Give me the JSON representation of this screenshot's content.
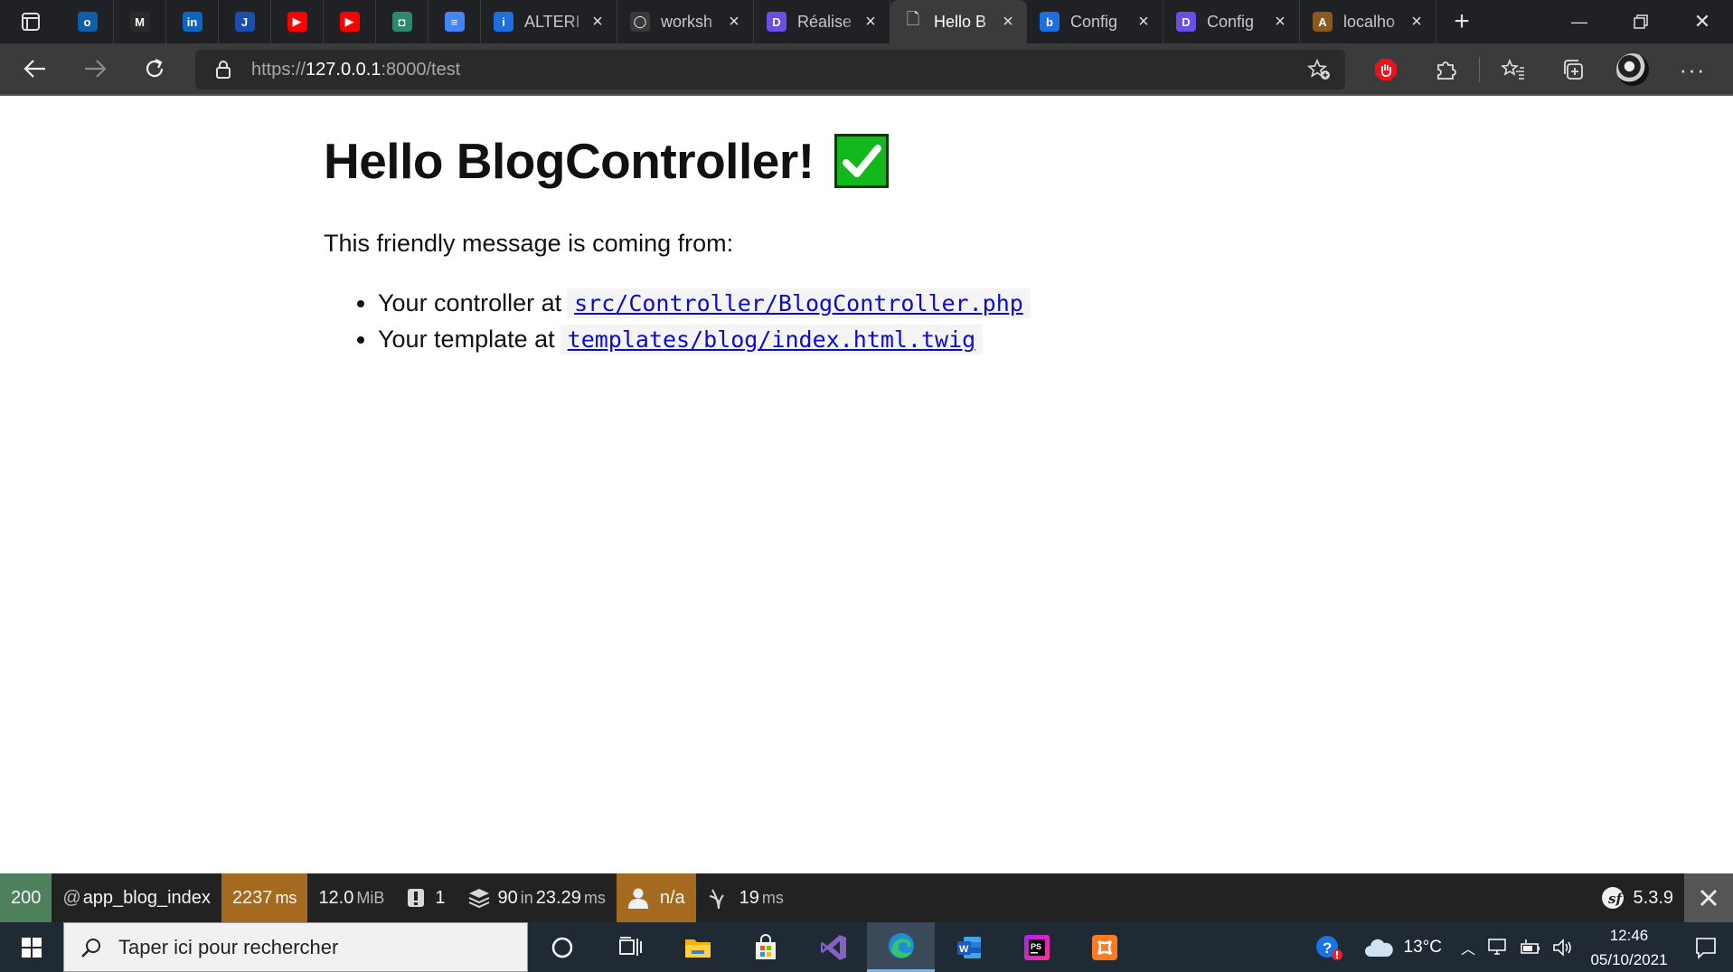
{
  "browser": {
    "pinned_tabs": [
      {
        "name": "outlook",
        "glyph": "o",
        "color": "#0f5ea8"
      },
      {
        "name": "gmail",
        "glyph": "M",
        "color": "#2a2a2a"
      },
      {
        "name": "linkedin",
        "glyph": "in",
        "color": "#0a66c2"
      },
      {
        "name": "jira",
        "glyph": "J",
        "color": "#1a4fb0"
      },
      {
        "name": "youtube",
        "glyph": "▶",
        "color": "#ff0000"
      },
      {
        "name": "youtube",
        "glyph": "▶",
        "color": "#ff0000"
      },
      {
        "name": "app",
        "glyph": "◘",
        "color": "#2d8a6e"
      },
      {
        "name": "docs",
        "glyph": "≡",
        "color": "#4285f4"
      }
    ],
    "tabs": [
      {
        "title": "ALTERI",
        "fav": "i",
        "fav_color": "#1d6fe0",
        "active": false
      },
      {
        "title": "worksh",
        "fav": "◯",
        "fav_color": "#3a3a3a",
        "active": false
      },
      {
        "title": "Réalise",
        "fav": "D",
        "fav_color": "#6b4ee8",
        "active": false
      },
      {
        "title": "Hello B",
        "fav": "🗋",
        "fav_color": "transparent",
        "active": true
      },
      {
        "title": "Config",
        "fav": "b",
        "fav_color": "#1b6fe0",
        "active": false
      },
      {
        "title": "Config",
        "fav": "D",
        "fav_color": "#6b4ee8",
        "active": false
      },
      {
        "title": "localho",
        "fav": "A",
        "fav_color": "#8a5a1e",
        "active": false
      }
    ],
    "address": {
      "prefix": "https://",
      "host": "127.0.0.1",
      "suffix": ":8000/test"
    }
  },
  "page": {
    "heading": "Hello BlogController!",
    "intro": "This friendly message is coming from:",
    "items": [
      {
        "label": "Your controller at",
        "link": "src/Controller/BlogController.php"
      },
      {
        "label": "Your template at",
        "link": "templates/blog/index.html.twig"
      }
    ]
  },
  "profiler": {
    "status": "200",
    "route_prefix": "@",
    "route": "app_blog_index",
    "time_value": "2237",
    "time_unit": "ms",
    "memory_value": "12.0",
    "memory_unit": "MiB",
    "logs_count": "1",
    "cache_calls": "90",
    "cache_in": "in",
    "cache_time": "23.29",
    "cache_unit": "ms",
    "user": "n/a",
    "twig_time": "19",
    "twig_unit": "ms",
    "symfony_version": "5.3.9"
  },
  "taskbar": {
    "search_placeholder": "Taper ici pour rechercher",
    "temperature": "13°C",
    "time": "12:46",
    "date": "05/10/2021"
  }
}
